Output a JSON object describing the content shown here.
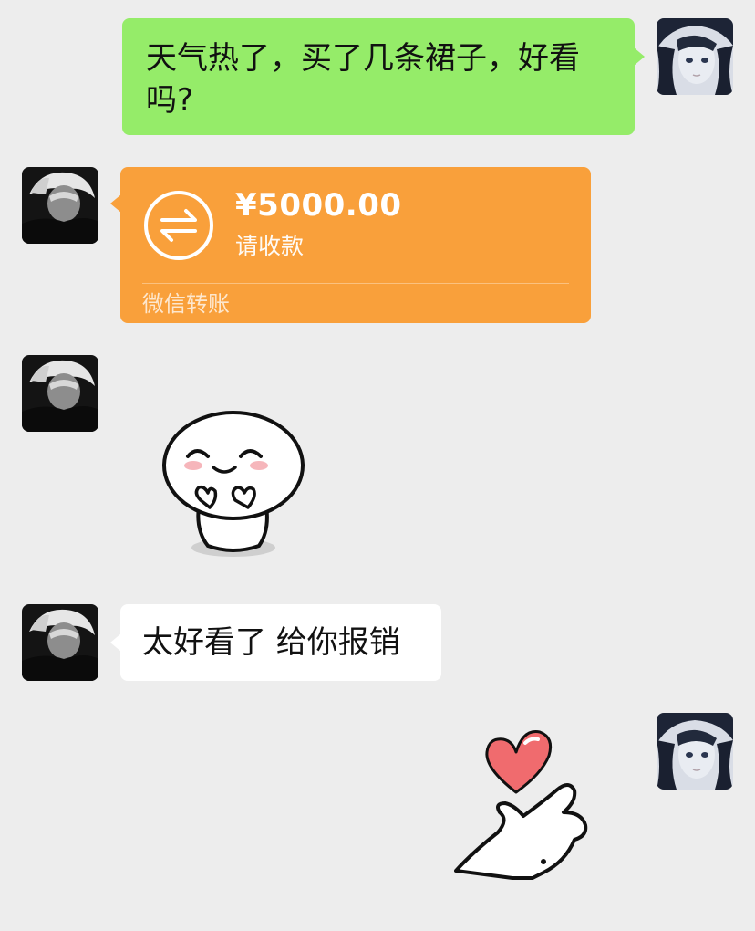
{
  "messages": {
    "m1_text": "天气热了，买了几条裙子，好看吗?",
    "transfer": {
      "amount": "¥5000.00",
      "status": "请收款",
      "label": "微信转账"
    },
    "m4_text": "太好看了 给你报销"
  },
  "icons": {
    "transfer": "transfer-arrows-icon",
    "sticker_1": "happy-blob-sticker",
    "sticker_2": "heart-finger-sticker"
  },
  "colors": {
    "background": "#ededed",
    "self_bubble": "#95ec69",
    "other_bubble": "#ffffff",
    "transfer_card": "#f9a03b"
  }
}
